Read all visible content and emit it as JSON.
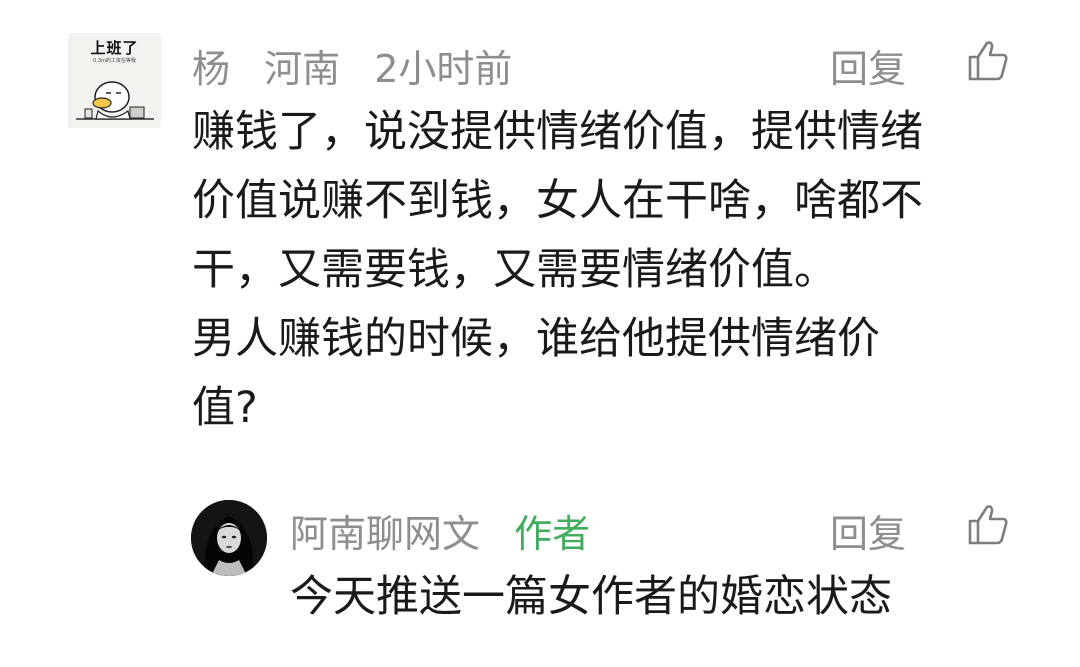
{
  "comment": {
    "avatar_sticker": {
      "title": "上班了",
      "subtitle": "0.3m的工资在等我"
    },
    "user": "杨",
    "location": "河南",
    "time": "2小时前",
    "reply_label": "回复",
    "lines": [
      "赚钱了，说没提供情绪价值，提供情绪",
      "价值说赚不到钱，女人在干啥，啥都不",
      "干，又需要钱，又需要情绪价值。",
      "男人赚钱的时候，谁给他提供情绪价",
      "值?"
    ]
  },
  "reply": {
    "user": "阿南聊网文",
    "author_tag": "作者",
    "reply_label": "回复",
    "text": "今天推送一篇女作者的婚恋状态"
  },
  "colors": {
    "meta_gray": "#8e8e8e",
    "author_green": "#43ad5f",
    "text_dark": "#1a1a1a"
  },
  "icons": {
    "like": "thumbs-up-icon",
    "avatar_sticker": "duck-sticker-avatar",
    "avatar_round": "girl-portrait-avatar"
  }
}
